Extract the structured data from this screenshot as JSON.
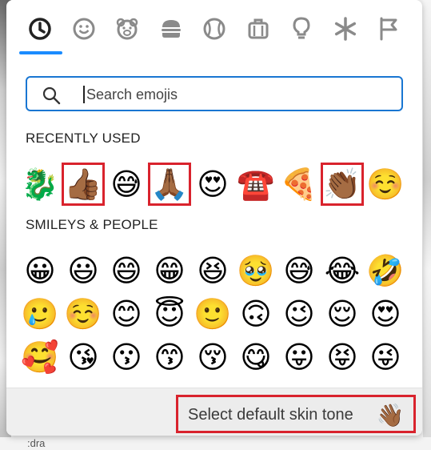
{
  "tabs": [
    {
      "name": "recent",
      "icon": "clock-icon"
    },
    {
      "name": "smileys",
      "icon": "smiley-icon"
    },
    {
      "name": "animals",
      "icon": "bear-icon"
    },
    {
      "name": "food",
      "icon": "burger-icon"
    },
    {
      "name": "activities",
      "icon": "ball-icon"
    },
    {
      "name": "travel",
      "icon": "suitcase-icon"
    },
    {
      "name": "objects",
      "icon": "lightbulb-icon"
    },
    {
      "name": "symbols",
      "icon": "asterisk-icon"
    },
    {
      "name": "flags",
      "icon": "flag-icon"
    }
  ],
  "colors": {
    "accent": "#1a8cff",
    "search_border": "#1976d2",
    "highlight": "#d9232d",
    "icon_gray": "#8a8a8a"
  },
  "search": {
    "placeholder": "Search emojis"
  },
  "sections": {
    "recent": {
      "title": "RECENTLY USED",
      "emojis": [
        "🐉",
        "👍🏾",
        "😅",
        "🙏🏾",
        "😍",
        "☎️",
        "🍕",
        "👏🏾",
        "☺️"
      ]
    },
    "smileys": {
      "title": "SMILEYS & PEOPLE",
      "rows": [
        [
          "😀",
          "😃",
          "😄",
          "😁",
          "😆",
          "🥹",
          "😅",
          "😂",
          "🤣"
        ],
        [
          "🥲",
          "☺️",
          "😊",
          "😇",
          "🙂",
          "🙃",
          "😉",
          "😌",
          "😍"
        ],
        [
          "🥰",
          "😘",
          "😗",
          "😙",
          "😚",
          "😋",
          "😛",
          "😝",
          "😜"
        ]
      ]
    }
  },
  "footer": {
    "skin_tone_label": "Select default skin tone",
    "skin_tone_icon": "👋🏾"
  },
  "background": {
    "bottom_text": ":dra"
  }
}
